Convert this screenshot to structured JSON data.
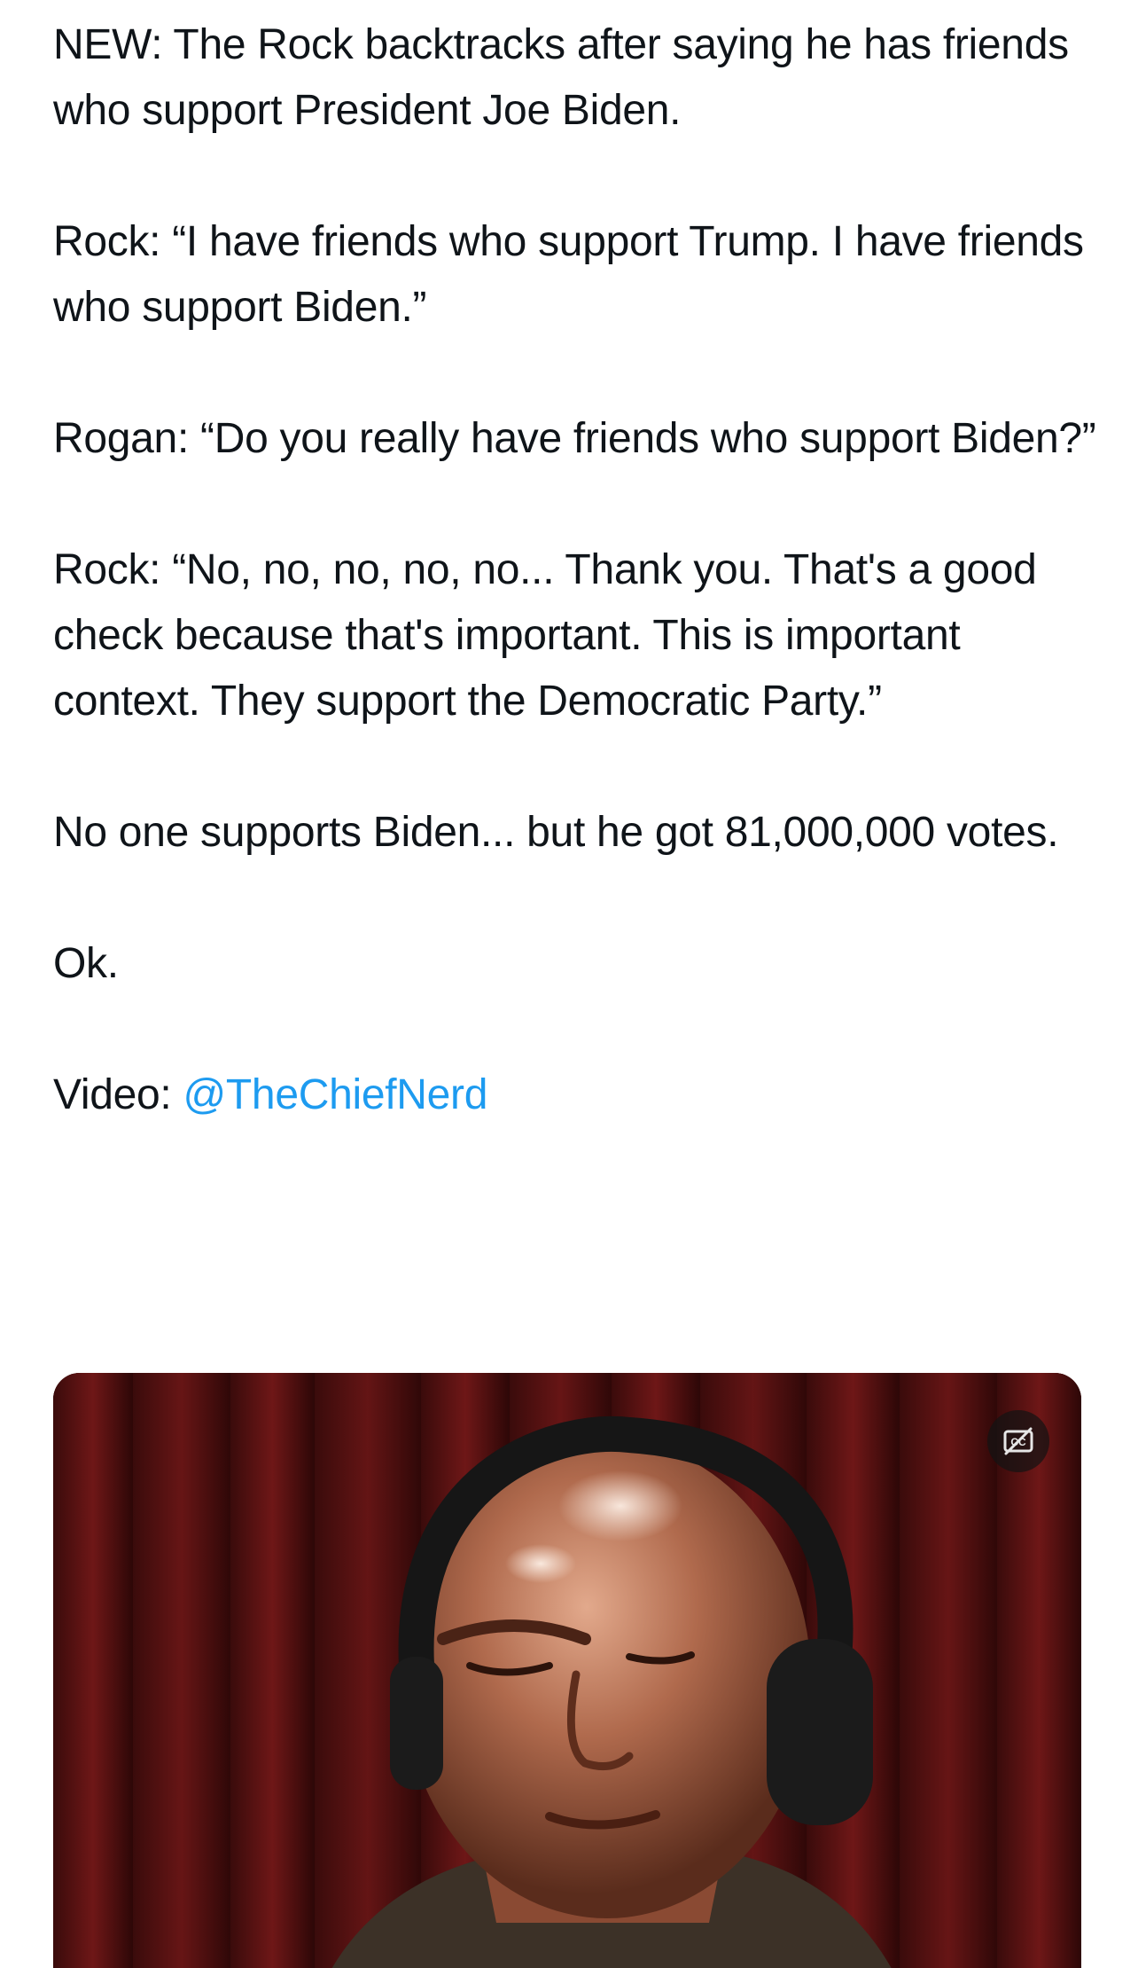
{
  "tweet": {
    "paragraphs": [
      "NEW: The Rock backtracks after saying he has friends who support President Joe Biden.",
      "Rock: “I have friends who support Trump. I have friends who support Biden.”",
      "Rogan: “Do you really have friends who support Biden?”",
      "Rock: “No, no, no, no, no... Thank you. That's a good check because that's important. This is important context. They support the Democratic Party.”",
      "No one supports Biden... but he got 81,000,000 votes.",
      "Ok."
    ],
    "video_credit_prefix": "Video: ",
    "video_credit_mention": "@TheChiefNerd"
  },
  "media": {
    "type": "video",
    "cc_icon": "closed-captions-off-icon"
  },
  "colors": {
    "text": "#0f1419",
    "link": "#1d9bf0",
    "background": "#ffffff"
  }
}
